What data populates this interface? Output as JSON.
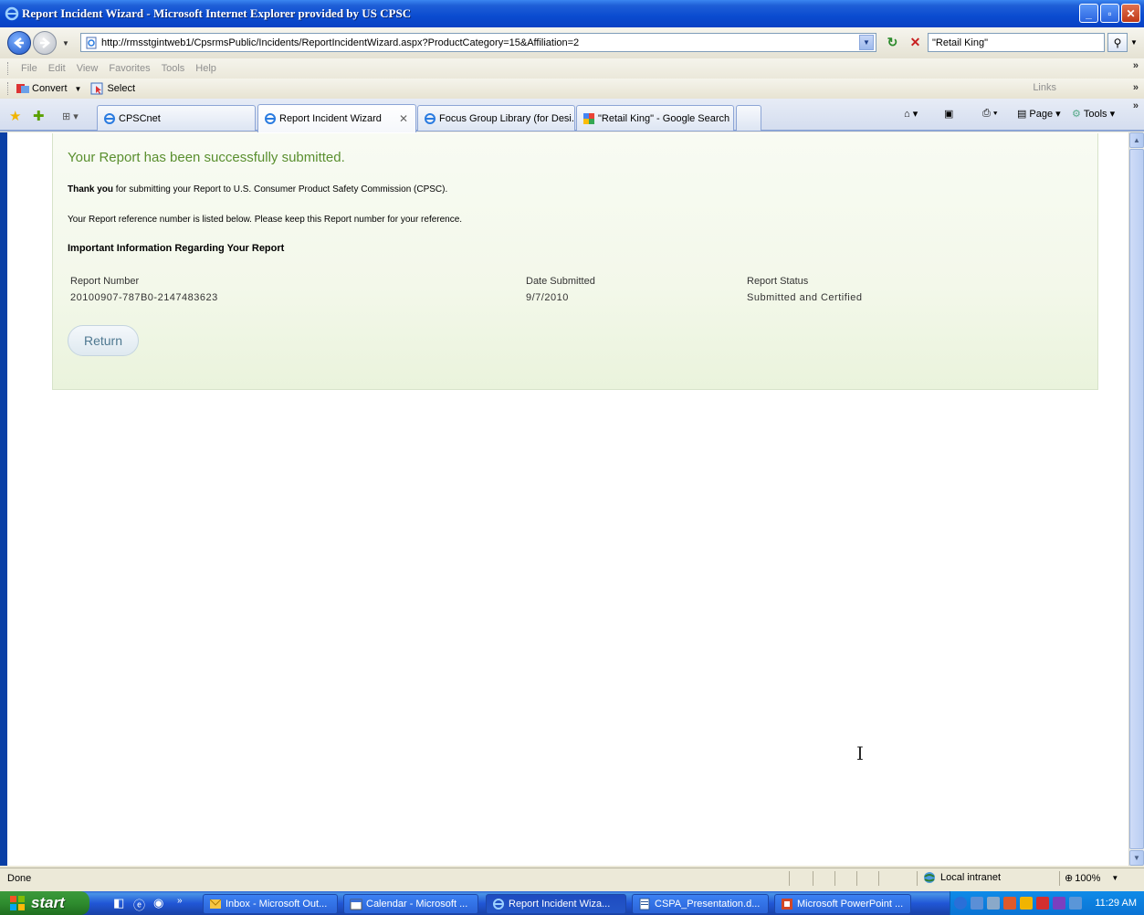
{
  "window": {
    "title": "Report Incident Wizard - Microsoft Internet Explorer provided by US CPSC"
  },
  "address": {
    "url": "http://rmsstgintweb1/CpsrmsPublic/Incidents/ReportIncidentWizard.aspx?ProductCategory=15&Affiliation=2",
    "search_value": "\"Retail King\""
  },
  "menu": {
    "items": [
      "File",
      "Edit",
      "View",
      "Favorites",
      "Tools",
      "Help"
    ]
  },
  "command": {
    "convert": "Convert",
    "select": "Select",
    "links": "Links"
  },
  "tabs": {
    "items": [
      {
        "label": "CPSCnet"
      },
      {
        "label": "Report Incident Wizard"
      },
      {
        "label": "Focus Group Library (for Desi..."
      },
      {
        "label": "\"Retail King\" - Google Search"
      }
    ],
    "page_label": "Page",
    "tools_label": "Tools"
  },
  "content": {
    "heading": "Your Report has been successfully submitted.",
    "thank_bold": "Thank you",
    "thank_rest": " for submitting your Report to U.S. Consumer Product Safety Commission (CPSC).",
    "reference_text": "Your Report reference number is listed below. Please keep this Report number for your reference.",
    "important": "Important Information Regarding Your Report",
    "columns": {
      "report_number_label": "Report Number",
      "report_number_value": "20100907-787B0-2147483623",
      "date_label": "Date Submitted",
      "date_value": "9/7/2010",
      "status_label": "Report Status",
      "status_value": "Submitted and Certified"
    },
    "return_label": "Return"
  },
  "status": {
    "text": "Done",
    "zone": "Local intranet",
    "zoom": "100%"
  },
  "taskbar": {
    "start": "start",
    "buttons": [
      {
        "label": "Inbox - Microsoft Out..."
      },
      {
        "label": "Calendar - Microsoft ..."
      },
      {
        "label": "Report Incident Wiza..."
      },
      {
        "label": "CSPA_Presentation.d..."
      },
      {
        "label": "Microsoft PowerPoint ..."
      }
    ],
    "clock": "11:29 AM"
  }
}
